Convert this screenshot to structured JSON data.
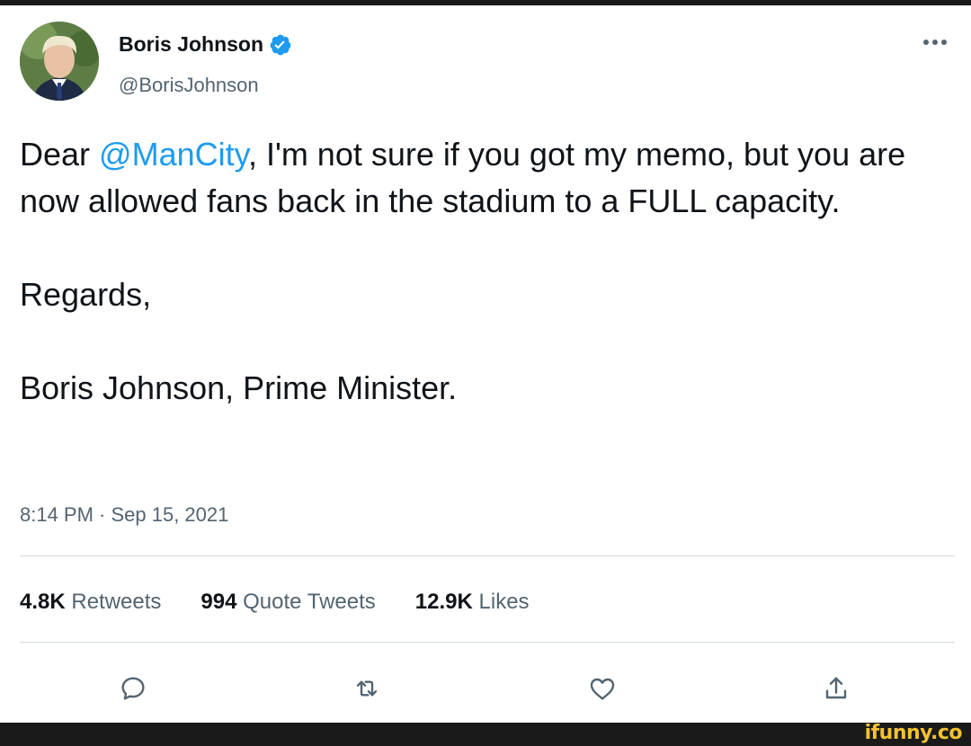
{
  "author": {
    "display_name": "Boris Johnson",
    "handle": "@BorisJohnson",
    "verified": true
  },
  "more_icon": "more-horizontal-icon",
  "tweet": {
    "line1_prefix": "Dear ",
    "mention": "@ManCity",
    "line1_suffix": ", I'm not sure if you got my memo, but you are now allowed fans back in the stadium to a FULL capacity.",
    "regards": "Regards,",
    "signature": "Boris Johnson, Prime Minister."
  },
  "timestamp": "8:14 PM · Sep 15, 2021",
  "stats": {
    "retweets_count": "4.8K",
    "retweets_label": "Retweets",
    "quotes_count": "994",
    "quotes_label": "Quote Tweets",
    "likes_count": "12.9K",
    "likes_label": "Likes"
  },
  "actions": [
    "reply-icon",
    "retweet-icon",
    "like-icon",
    "share-icon"
  ],
  "colors": {
    "mention": "#1d9bf0",
    "verified": "#1d9bf0",
    "secondary_text": "#536471",
    "watermark": "#f2c230"
  },
  "watermark": "ifunny.co"
}
